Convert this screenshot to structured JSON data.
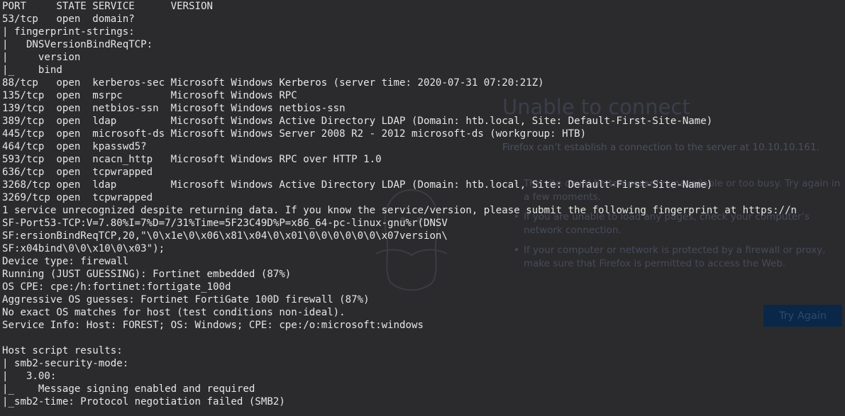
{
  "browser_error": {
    "title": "Unable to connect",
    "description": "Firefox can’t establish a connection to the server at 10.10.10.161.",
    "bullets": [
      "The site could be temporarily unavailable or too busy. Try again in a few moments.",
      "If you are unable to load any pages, check your computer’s network connection.",
      "If your computer or network is protected by a firewall or proxy, make sure that Firefox is permitted to access the Web."
    ],
    "try_again_label": "Try Again"
  },
  "terminal": {
    "lines": [
      "PORT     STATE SERVICE      VERSION",
      "53/tcp   open  domain?",
      "| fingerprint-strings:",
      "|   DNSVersionBindReqTCP:",
      "|     version",
      "|_    bind",
      "88/tcp   open  kerberos-sec Microsoft Windows Kerberos (server time: 2020-07-31 07:20:21Z)",
      "135/tcp  open  msrpc        Microsoft Windows RPC",
      "139/tcp  open  netbios-ssn  Microsoft Windows netbios-ssn",
      "389/tcp  open  ldap         Microsoft Windows Active Directory LDAP (Domain: htb.local, Site: Default-First-Site-Name)",
      "445/tcp  open  microsoft-ds Microsoft Windows Server 2008 R2 - 2012 microsoft-ds (workgroup: HTB)",
      "464/tcp  open  kpasswd5?",
      "593/tcp  open  ncacn_http   Microsoft Windows RPC over HTTP 1.0",
      "636/tcp  open  tcpwrapped",
      "3268/tcp open  ldap         Microsoft Windows Active Directory LDAP (Domain: htb.local, Site: Default-First-Site-Name)",
      "3269/tcp open  tcpwrapped",
      "1 service unrecognized despite returning data. If you know the service/version, please submit the following fingerprint at https://n",
      "SF-Port53-TCP:V=7.80%I=7%D=7/31%Time=5F23C49D%P=x86_64-pc-linux-gnu%r(DNSV",
      "SF:ersionBindReqTCP,20,\"\\0\\x1e\\0\\x06\\x81\\x04\\0\\x01\\0\\0\\0\\0\\0\\0\\x07version\\",
      "SF:x04bind\\0\\0\\x10\\0\\x03\");",
      "Device type: firewall",
      "Running (JUST GUESSING): Fortinet embedded (87%)",
      "OS CPE: cpe:/h:fortinet:fortigate_100d",
      "Aggressive OS guesses: Fortinet FortiGate 100D firewall (87%)",
      "No exact OS matches for host (test conditions non-ideal).",
      "Service Info: Host: FOREST; OS: Windows; CPE: cpe:/o:microsoft:windows",
      "",
      "Host script results:",
      "| smb2-security-mode:",
      "|   3.00:",
      "|_    Message signing enabled and required",
      "|_smb2-time: Protocol negotiation failed (SMB2)"
    ]
  }
}
